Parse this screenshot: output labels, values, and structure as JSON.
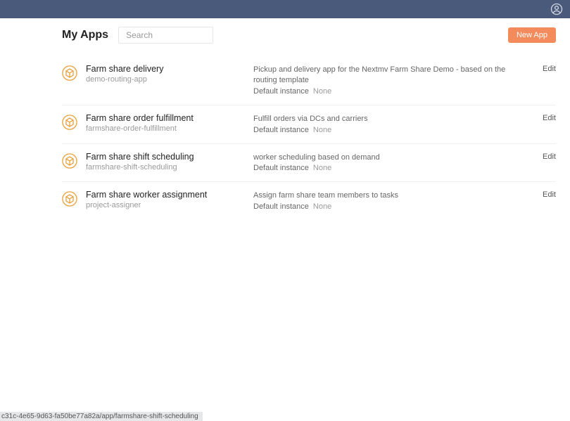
{
  "header": {
    "title": "My Apps",
    "search_placeholder": "Search",
    "new_app_label": "New App"
  },
  "list": {
    "instance_label": "Default instance",
    "edit_label": "Edit"
  },
  "apps": [
    {
      "name": "Farm share delivery",
      "slug": "demo-routing-app",
      "description": "Pickup and delivery app for the Nextmv Farm Share Demo - based on the routing template",
      "instance": "None"
    },
    {
      "name": "Farm share order fulfillment",
      "slug": "farmshare-order-fulfillment",
      "description": "Fulfill orders via DCs and carriers",
      "instance": "None"
    },
    {
      "name": "Farm share shift scheduling",
      "slug": "farmshare-shift-scheduling",
      "description": "worker scheduling based on demand",
      "instance": "None"
    },
    {
      "name": "Farm share worker assignment",
      "slug": "project-assigner",
      "description": "Assign farm share team members to tasks",
      "instance": "None"
    }
  ],
  "status_bar": "c31c-4e65-9d63-fa50be77a82a/app/farmshare-shift-scheduling",
  "colors": {
    "topbar": "#4a5a7a",
    "accent": "#f38b5c",
    "icon_ring": "#e8a03a"
  }
}
